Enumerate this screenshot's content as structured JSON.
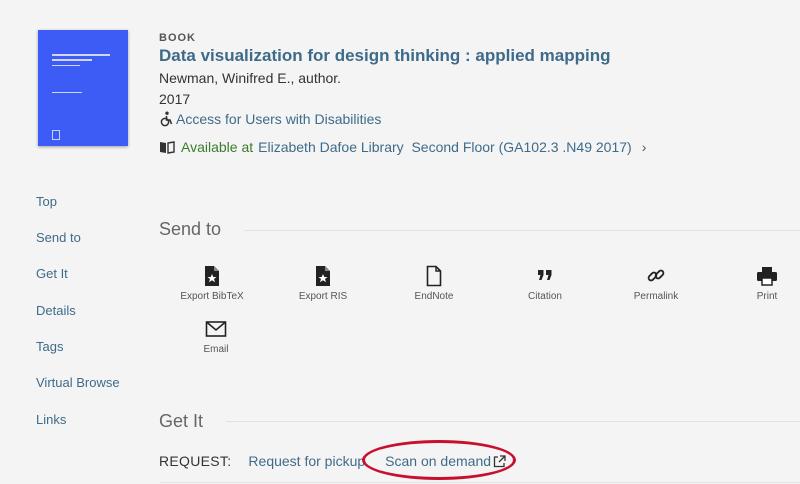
{
  "record": {
    "type": "BOOK",
    "title": "Data visualization for design thinking : applied mapping",
    "author": "Newman, Winifred E., author.",
    "year": "2017",
    "access_link": "Access for Users with Disabilities",
    "availability": {
      "status": "Available at",
      "location": "Elizabeth Dafoe Library  Second Floor (GA102.3 .N49 2017)"
    }
  },
  "sidebar": {
    "items": [
      "Top",
      "Send to",
      "Get It",
      "Details",
      "Tags",
      "Virtual Browse",
      "Links"
    ]
  },
  "send_to": {
    "heading": "Send to",
    "actions": [
      {
        "label": "Export BibTeX",
        "icon": "export-bibtex-icon"
      },
      {
        "label": "Export RIS",
        "icon": "export-ris-icon"
      },
      {
        "label": "EndNote",
        "icon": "document-icon"
      },
      {
        "label": "Citation",
        "icon": "quote-icon"
      },
      {
        "label": "Permalink",
        "icon": "link-icon"
      },
      {
        "label": "Print",
        "icon": "printer-icon"
      },
      {
        "label": "Email",
        "icon": "envelope-icon"
      }
    ]
  },
  "get_it": {
    "heading": "Get It",
    "request_label": "REQUEST:",
    "pickup_link": "Request for pickup",
    "scan_link": "Scan on demand"
  },
  "colors": {
    "link": "#3e6b8a",
    "available": "#3a7d2c",
    "highlight": "#c8102e",
    "cover": "#3d5bf5"
  }
}
